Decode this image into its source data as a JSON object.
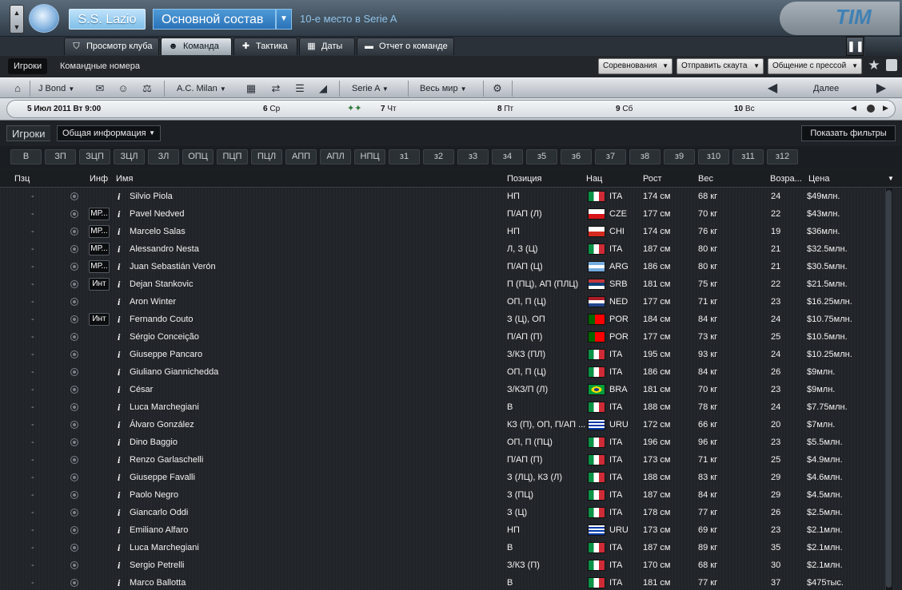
{
  "header": {
    "club_name": "S.S. Lazio",
    "squad_label": "Основной состав",
    "league_position": "10-е место в Serie A",
    "sponsor": "TIM"
  },
  "tabs": [
    {
      "label": "Просмотр клуба",
      "icon": "shield-icon",
      "active": false
    },
    {
      "label": "Команда",
      "icon": "people-icon",
      "active": true
    },
    {
      "label": "Тактика",
      "icon": "tactics-icon",
      "active": false
    },
    {
      "label": "Даты",
      "icon": "calendar-icon",
      "active": false
    },
    {
      "label": "Отчет о команде",
      "icon": "report-icon",
      "active": false
    }
  ],
  "subnav": {
    "players": "Игроки",
    "numbers": "Командные номера",
    "competitions": "Соревнования",
    "send_scout": "Отправить скаута",
    "press": "Общение с прессой"
  },
  "navbar": {
    "user": "J Bond",
    "club": "A.C. Milan",
    "league": "Serie A",
    "region": "Весь мир",
    "continue": "Далее"
  },
  "calendar": [
    {
      "num": "5 Июл 2011",
      "day": "Вт 9:00"
    },
    {
      "num": "6",
      "day": "Ср"
    },
    {
      "num": "7",
      "day": "Чт"
    },
    {
      "num": "8",
      "day": "Пт"
    },
    {
      "num": "9",
      "day": "Сб"
    },
    {
      "num": "10",
      "day": "Вс"
    }
  ],
  "panel": {
    "title": "Игроки",
    "view": "Общая информация",
    "filters": "Показать фильтры"
  },
  "position_filters": [
    "В",
    "ЗП",
    "ЗЦП",
    "ЗЦЛ",
    "ЗЛ",
    "ОПЦ",
    "ПЦП",
    "ПЦЛ",
    "АПП",
    "АПЛ",
    "НПЦ",
    "з1",
    "з2",
    "з3",
    "з4",
    "з5",
    "з6",
    "з7",
    "з8",
    "з9",
    "з10",
    "з11",
    "з12"
  ],
  "columns": {
    "pos": "Пзц",
    "info": "Инф",
    "name": "Имя",
    "position": "Позиция",
    "nat": "Нац",
    "height": "Рост",
    "weight": "Вес",
    "age": "Возра...",
    "value": "Цена"
  },
  "players": [
    {
      "pz": "-",
      "inf": "",
      "name": "Silvio Piola",
      "position": "НП",
      "nat": "ITA",
      "flag": "ita",
      "height": "174 см",
      "weight": "68 кг",
      "age": "24",
      "value": "$49млн."
    },
    {
      "pz": "-",
      "inf": "МР...",
      "name": "Pavel Nedved",
      "position": "П/АП (Л)",
      "nat": "CZE",
      "flag": "cze",
      "height": "177 см",
      "weight": "70 кг",
      "age": "22",
      "value": "$43млн."
    },
    {
      "pz": "-",
      "inf": "МР...",
      "name": "Marcelo Salas",
      "position": "НП",
      "nat": "CHI",
      "flag": "chi",
      "height": "174 см",
      "weight": "76 кг",
      "age": "19",
      "value": "$36млн."
    },
    {
      "pz": "-",
      "inf": "МР...",
      "name": "Alessandro Nesta",
      "position": "Л, З (Ц)",
      "nat": "ITA",
      "flag": "ita",
      "height": "187 см",
      "weight": "80 кг",
      "age": "21",
      "value": "$32.5млн."
    },
    {
      "pz": "-",
      "inf": "МР...",
      "name": "Juan Sebastián Verón",
      "position": "П/АП (Ц)",
      "nat": "ARG",
      "flag": "arg",
      "height": "186 см",
      "weight": "80 кг",
      "age": "21",
      "value": "$30.5млн."
    },
    {
      "pz": "-",
      "inf": "Инт",
      "name": "Dejan Stankovic",
      "position": "П (ПЦ), АП (ПЛЦ)",
      "nat": "SRB",
      "flag": "srb",
      "height": "181 см",
      "weight": "75 кг",
      "age": "22",
      "value": "$21.5млн."
    },
    {
      "pz": "-",
      "inf": "",
      "name": "Aron Winter",
      "position": "ОП, П (Ц)",
      "nat": "NED",
      "flag": "ned",
      "height": "177 см",
      "weight": "71 кг",
      "age": "23",
      "value": "$16.25млн."
    },
    {
      "pz": "-",
      "inf": "Инт",
      "name": "Fernando Couto",
      "position": "З (Ц), ОП",
      "nat": "POR",
      "flag": "por",
      "height": "184 см",
      "weight": "84 кг",
      "age": "24",
      "value": "$10.75млн."
    },
    {
      "pz": "-",
      "inf": "",
      "name": "Sérgio Conceição",
      "position": "П/АП (П)",
      "nat": "POR",
      "flag": "por",
      "height": "177 см",
      "weight": "73 кг",
      "age": "25",
      "value": "$10.5млн."
    },
    {
      "pz": "-",
      "inf": "",
      "name": "Giuseppe Pancaro",
      "position": "З/КЗ (ПЛ)",
      "nat": "ITA",
      "flag": "ita",
      "height": "195 см",
      "weight": "93 кг",
      "age": "24",
      "value": "$10.25млн."
    },
    {
      "pz": "-",
      "inf": "",
      "name": "Giuliano Giannichedda",
      "position": "ОП, П (Ц)",
      "nat": "ITA",
      "flag": "ita",
      "height": "186 см",
      "weight": "84 кг",
      "age": "26",
      "value": "$9млн."
    },
    {
      "pz": "-",
      "inf": "",
      "name": "César",
      "position": "З/КЗ/П (Л)",
      "nat": "BRA",
      "flag": "bra",
      "height": "181 см",
      "weight": "70 кг",
      "age": "23",
      "value": "$9млн."
    },
    {
      "pz": "-",
      "inf": "",
      "name": "Luca Marchegiani",
      "position": "В",
      "nat": "ITA",
      "flag": "ita",
      "height": "188 см",
      "weight": "78 кг",
      "age": "24",
      "value": "$7.75млн."
    },
    {
      "pz": "-",
      "inf": "",
      "name": "Álvaro González",
      "position": "КЗ (П), ОП, П/АП ...",
      "nat": "URU",
      "flag": "uru",
      "height": "172 см",
      "weight": "66 кг",
      "age": "20",
      "value": "$7млн."
    },
    {
      "pz": "-",
      "inf": "",
      "name": "Dino Baggio",
      "position": "ОП, П (ПЦ)",
      "nat": "ITA",
      "flag": "ita",
      "height": "196 см",
      "weight": "96 кг",
      "age": "23",
      "value": "$5.5млн."
    },
    {
      "pz": "-",
      "inf": "",
      "name": "Renzo Garlaschelli",
      "position": "П/АП (П)",
      "nat": "ITA",
      "flag": "ita",
      "height": "173 см",
      "weight": "71 кг",
      "age": "25",
      "value": "$4.9млн."
    },
    {
      "pz": "-",
      "inf": "",
      "name": "Giuseppe Favalli",
      "position": "З (ЛЦ), КЗ (Л)",
      "nat": "ITA",
      "flag": "ita",
      "height": "188 см",
      "weight": "83 кг",
      "age": "29",
      "value": "$4.6млн."
    },
    {
      "pz": "-",
      "inf": "",
      "name": "Paolo Negro",
      "position": "З (ПЦ)",
      "nat": "ITA",
      "flag": "ita",
      "height": "187 см",
      "weight": "84 кг",
      "age": "29",
      "value": "$4.5млн."
    },
    {
      "pz": "-",
      "inf": "",
      "name": "Giancarlo Oddi",
      "position": "З (Ц)",
      "nat": "ITA",
      "flag": "ita",
      "height": "178 см",
      "weight": "77 кг",
      "age": "26",
      "value": "$2.5млн."
    },
    {
      "pz": "-",
      "inf": "",
      "name": "Emiliano Alfaro",
      "position": "НП",
      "nat": "URU",
      "flag": "uru",
      "height": "173 см",
      "weight": "69 кг",
      "age": "23",
      "value": "$2.1млн."
    },
    {
      "pz": "-",
      "inf": "",
      "name": "Luca Marchegiani",
      "position": "В",
      "nat": "ITA",
      "flag": "ita",
      "height": "187 см",
      "weight": "89 кг",
      "age": "35",
      "value": "$2.1млн."
    },
    {
      "pz": "-",
      "inf": "",
      "name": "Sergio Petrelli",
      "position": "З/КЗ (П)",
      "nat": "ITA",
      "flag": "ita",
      "height": "170 см",
      "weight": "68 кг",
      "age": "30",
      "value": "$2.1млн."
    },
    {
      "pz": "-",
      "inf": "",
      "name": "Marco Ballotta",
      "position": "В",
      "nat": "ITA",
      "flag": "ita",
      "height": "181 см",
      "weight": "77 кг",
      "age": "37",
      "value": "$475тыс."
    }
  ],
  "flags": {
    "ita": "linear-gradient(90deg,#0a9246 0 33%,#ffffff 33% 66%,#ce2b37 66%)",
    "cze": "linear-gradient(180deg,#ffffff 0 50%,#d7141a 50%)",
    "chi": "linear-gradient(180deg,#ffffff 0 50%,#d52b1e 50%)",
    "arg": "linear-gradient(180deg,#74acdf 0 33%,#ffffff 33% 66%,#74acdf 66%)",
    "srb": "linear-gradient(180deg,#c6363c 0 33%,#0c4076 33% 66%,#ffffff 66%)",
    "ned": "linear-gradient(180deg,#ae1c28 0 33%,#ffffff 33% 66%,#21468b 66%)",
    "por": "linear-gradient(90deg,#006600 0 40%,#ff0000 40%)",
    "bra": "radial-gradient(ellipse at center,#1a3e8c 0 22%,#fedf00 23% 45%,#009c3b 46%)",
    "uru": "repeating-linear-gradient(180deg,#ffffff 0 2px,#0038a8 2px 4px)"
  }
}
